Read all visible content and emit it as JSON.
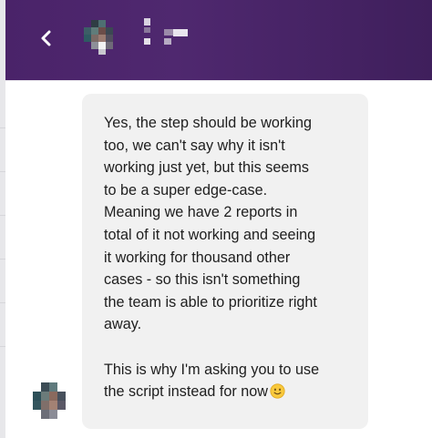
{
  "header": {
    "back_icon": "chevron-left-icon",
    "background": "#4b2569",
    "contact_avatar": "blurred-avatar",
    "contact_name": "blurred-name"
  },
  "message": {
    "sender_avatar": "blurred-avatar",
    "paragraph_1": "Yes, the step should be working\ntoo, we can't say why it isn't\nworking just yet, but this seems\nto be a super edge-case.\nMeaning we have 2 reports in\ntotal of it not working and seeing\nit working for thousand other\ncases - so this isn't something\nthe team is able to prioritize right\naway.",
    "paragraph_2": "This is why I'm asking you to use\nthe script instead for now",
    "emoji": "slightly-smiling-face-emoji"
  }
}
